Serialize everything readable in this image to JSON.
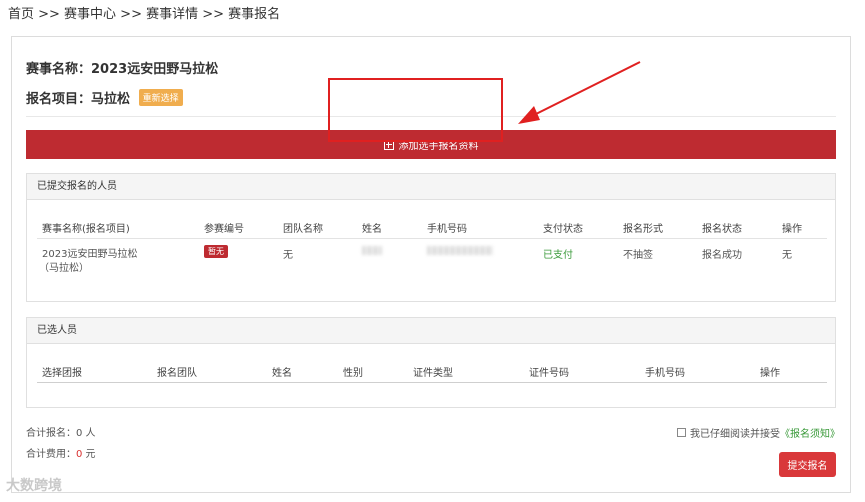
{
  "breadcrumb": "首页 >> 赛事中心 >> 赛事详情 >> 赛事报名",
  "event": {
    "name_label": "赛事名称：",
    "name": "2023远安田野马拉松",
    "project_label": "报名项目：",
    "project": "马拉松",
    "reselect": "重新选择"
  },
  "add_button": "添加选手报名资料",
  "submitted": {
    "title": "已提交报名的人员",
    "headers": [
      "赛事名称(报名项目)",
      "参赛编号",
      "团队名称",
      "姓名",
      "手机号码",
      "支付状态",
      "报名形式",
      "报名状态",
      "操作"
    ],
    "row": {
      "event_line1": "2023远安田野马拉松",
      "event_line2": "（马拉松）",
      "bib": "暂无",
      "team": "无",
      "payment": "已支付",
      "form": "不抽签",
      "status": "报名成功",
      "action": "无"
    }
  },
  "selected": {
    "title": "已选人员",
    "headers": [
      "选择团报",
      "报名团队",
      "姓名",
      "性别",
      "证件类型",
      "证件号码",
      "手机号码",
      "操作"
    ]
  },
  "totals": {
    "count_label": "合计报名：",
    "count": "0",
    "count_unit": " 人",
    "fee_label": "合计费用：",
    "fee": "0",
    "fee_unit": " 元"
  },
  "agree": {
    "text": "我已仔细阅读并接受",
    "link": "《报名须知》"
  },
  "submit": "提交报名",
  "watermark": "大数跨境",
  "colors": {
    "accent": "#be2b31",
    "badge": "#f0ad4e",
    "paid": "#3a9a3a"
  }
}
